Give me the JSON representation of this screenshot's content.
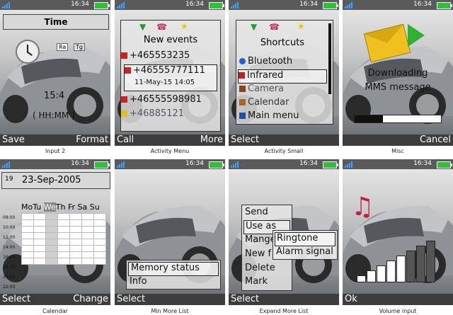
{
  "screens": {
    "input2": {
      "time": "16:34",
      "title": "Time",
      "tag_ra": "Ra",
      "tag_tg": "Tg",
      "value": "15:4",
      "format": "( HH:MM )",
      "left": "Save",
      "right": "Format",
      "caption": "Input 2"
    },
    "activity_menu": {
      "time": "16:34",
      "title": "New events",
      "items": [
        "+465553235",
        "+46555777111",
        "11-May-15   14:05",
        "+46555598981",
        "+46885121"
      ],
      "left": "Call",
      "right": "More",
      "caption": "Activity Menu"
    },
    "activity_small": {
      "time": "16:34",
      "title": "Shortcuts",
      "items": [
        "Bluetooth",
        "Infrared",
        "Camera",
        "Calendar",
        "Main menu"
      ],
      "left": "Select",
      "right": "",
      "caption": "Activity Small"
    },
    "misc": {
      "time": "16:34",
      "line1": "Downloading",
      "line2": "MMS message",
      "progress": 0.33,
      "left": "",
      "right": "Cancel",
      "caption": "Misc"
    },
    "calendar": {
      "time": "16:34",
      "date_day": "19",
      "date": "23-Sep-2005",
      "days": [
        "Mo",
        "Tu",
        "We",
        "Th",
        "Fr",
        "Sa",
        "Su"
      ],
      "hours": [
        "08:00",
        "10:00",
        "12:00",
        "14:00",
        "16:00",
        "18:00",
        "20:00",
        "22:00"
      ],
      "left": "Select",
      "right": "Change",
      "caption": "Calendar"
    },
    "min_more": {
      "time": "16:34",
      "items": [
        "Memory status",
        "Info"
      ],
      "left": "Select",
      "right": "",
      "caption": "Min More List"
    },
    "expand_more": {
      "time": "16:34",
      "items": [
        "Send",
        "Use as",
        "Mange",
        "New f",
        "Delete",
        "Mark"
      ],
      "sub": [
        "Ringtone",
        "Alarm signal"
      ],
      "left": "Select",
      "right": "",
      "caption": "Expand More List"
    },
    "volume": {
      "time": "16:34",
      "level": 0.7,
      "left": "Ok",
      "right": "",
      "caption": "Volume input"
    }
  },
  "colors": {
    "status": "#5a5a5a",
    "softbar": "#3d3d3d",
    "battery": "#2fbf3a",
    "signal": "#3aa3ff"
  }
}
